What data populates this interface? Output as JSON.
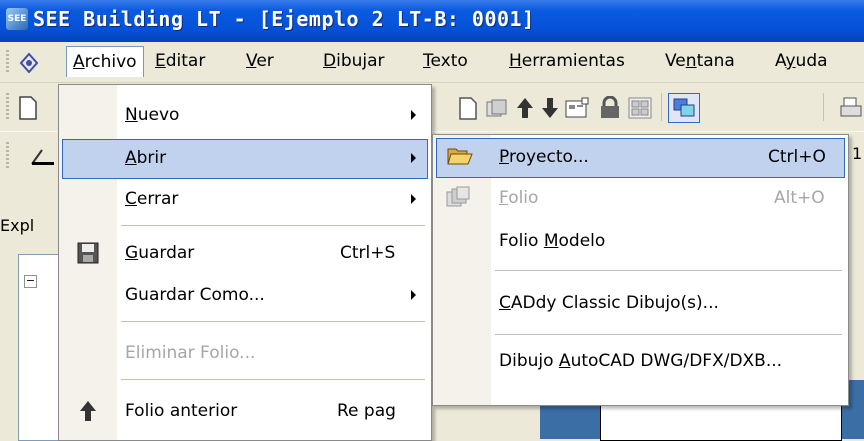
{
  "title": {
    "text": "SEE Building LT - [Ejemplo 2 LT-B: 0001]",
    "icon": "see-app-icon",
    "icon_text": "SEE"
  },
  "menubar": {
    "archivo": {
      "pre": "",
      "u": "A",
      "post": "rchivo"
    },
    "editar": {
      "pre": "",
      "u": "E",
      "post": "ditar"
    },
    "ver": {
      "pre": "",
      "u": "V",
      "post": "er"
    },
    "dibujar": {
      "pre": "",
      "u": "D",
      "post": "ibujar"
    },
    "texto": {
      "pre": "",
      "u": "T",
      "post": "exto"
    },
    "herramientas": {
      "pre": "",
      "u": "H",
      "post": "erramientas"
    },
    "ventana": {
      "pre": "Ve",
      "u": "n",
      "post": "tana"
    },
    "ayuda": {
      "pre": "A",
      "u": "y",
      "post": "uda"
    }
  },
  "explorer": {
    "label": "Expl",
    "tree_toggle": "−"
  },
  "toolbar2": {
    "partial_number": "1"
  },
  "archivo_menu": {
    "nuevo": {
      "pre": "",
      "u": "N",
      "post": "uevo"
    },
    "abrir": {
      "pre": "",
      "u": "A",
      "post": "brir"
    },
    "cerrar": {
      "pre": "",
      "u": "C",
      "post": "errar"
    },
    "guardar": {
      "pre": "",
      "u": "G",
      "post": "uardar",
      "shortcut": "Ctrl+S"
    },
    "guardar_como": {
      "label": "Guardar Como..."
    },
    "eliminar_folio": {
      "label": "Eliminar Folio..."
    },
    "folio_anterior": {
      "label": "Folio anterior",
      "shortcut": "Re pag"
    }
  },
  "abrir_submenu": {
    "proyecto": {
      "pre": "",
      "u": "P",
      "post": "royecto...",
      "shortcut": "Ctrl+O"
    },
    "folio": {
      "pre": "",
      "u": "F",
      "post": "olio",
      "shortcut": "Alt+O"
    },
    "folio_modelo": {
      "pre": "Folio ",
      "u": "M",
      "post": "odelo"
    },
    "caddy": {
      "pre": "",
      "u": "C",
      "post": "ADdy Classic Dibujo(s)..."
    },
    "autocad": {
      "pre": "Dibujo ",
      "u": "A",
      "post": "utoCAD DWG/DFX/DXB..."
    }
  },
  "colors": {
    "title_bar": "#0551D8",
    "highlight": "#C1D2EE",
    "highlight_border": "#316AC5",
    "disabled_text": "#A6A6A6"
  }
}
